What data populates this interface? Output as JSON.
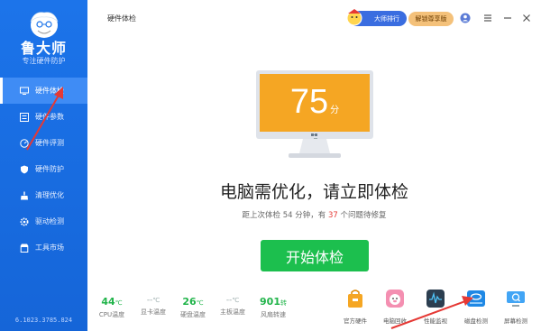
{
  "sidebar": {
    "brand": "鲁大师",
    "slogan": "专注硬件防护",
    "items": [
      {
        "label": "硬件体检",
        "icon": "monitor-icon",
        "active": true
      },
      {
        "label": "硬件参数",
        "icon": "list-icon"
      },
      {
        "label": "硬件评测",
        "icon": "gauge-icon"
      },
      {
        "label": "硬件防护",
        "icon": "shield-icon"
      },
      {
        "label": "清理优化",
        "icon": "broom-icon"
      },
      {
        "label": "驱动检测",
        "icon": "gear-icon"
      },
      {
        "label": "工具市场",
        "icon": "store-icon"
      }
    ],
    "version": "6.1023.3785.824"
  },
  "header": {
    "title": "硬件体检",
    "rank_label": "大师排行",
    "vip_label": "解锁尊享版"
  },
  "main": {
    "score": "75",
    "score_unit": "分",
    "headline": "电脑需优化，请立即体检",
    "sub_prefix": "距上次体检 54 分钟，有 ",
    "sub_count": "37",
    "sub_suffix": " 个问题待修复",
    "start_button": "开始体检"
  },
  "stats": [
    {
      "value": "44",
      "unit": "℃",
      "label": "CPU温度",
      "dim": false
    },
    {
      "value": "--",
      "unit": "℃",
      "label": "显卡温度",
      "dim": true
    },
    {
      "value": "26",
      "unit": "℃",
      "label": "硬盘温度",
      "dim": false
    },
    {
      "value": "--",
      "unit": "℃",
      "label": "主板温度",
      "dim": true
    },
    {
      "value": "901",
      "unit": "转",
      "label": "风扇转速",
      "dim": false
    }
  ],
  "tools": [
    {
      "label": "官方硬件",
      "icon": "shop-bag-icon",
      "color": "#f5a623"
    },
    {
      "label": "电脑回收",
      "icon": "piggy-icon",
      "color": "#f48fb1"
    },
    {
      "label": "性能监视",
      "icon": "monitor-wave-icon",
      "color": "#2c3e50"
    },
    {
      "label": "磁盘检测",
      "icon": "disk-icon",
      "color": "#1e88e5"
    },
    {
      "label": "屏幕检测",
      "icon": "screen-icon",
      "color": "#42a5f5"
    }
  ],
  "colors": {
    "sidebar": "#1c74ea",
    "accent_green": "#1cbf4e",
    "screen_orange": "#f5a623",
    "alert_red": "#e53935"
  }
}
